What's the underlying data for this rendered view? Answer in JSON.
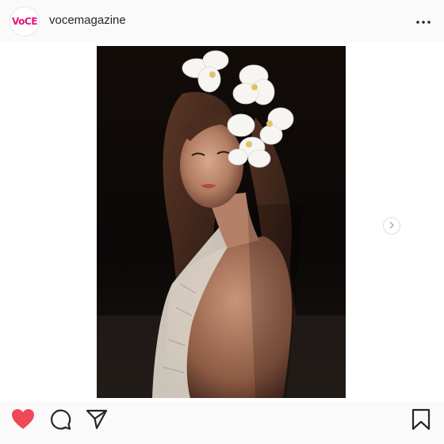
{
  "post": {
    "author": {
      "username": "vocemagazine",
      "avatar_logo_text": "VoCE"
    },
    "header_more_icon": "more-horizontal-icon",
    "carousel": {
      "next_icon": "chevron-right-icon"
    },
    "action_bar": {
      "like_icon": "heart-filled-icon",
      "comment_icon": "comment-icon",
      "share_icon": "paper-plane-icon",
      "save_icon": "bookmark-icon"
    }
  },
  "colors": {
    "brand_logo": "#e5157d",
    "liked_heart": "#ed4956",
    "text_primary": "#262626",
    "background": "#fafafa"
  }
}
